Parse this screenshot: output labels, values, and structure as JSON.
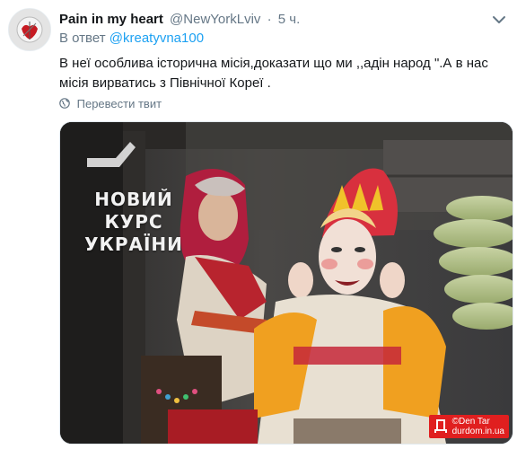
{
  "tweet": {
    "display_name": "Pain in my heart",
    "handle": "@NewYorkLviv",
    "separator": "·",
    "time": "5 ч.",
    "reply_prefix": "В ответ",
    "reply_mention": "@kreatyvna100",
    "text": "В неї особлива історична місія,доказати що ми ,,адін народ \".А в нас місія вирватись з Північної Кореї .",
    "translate_label": "Перевести твит"
  },
  "media": {
    "logo_lines": [
      "НОВИЙ",
      "КУРС",
      "УКРАЇНИ"
    ],
    "watermark_line1": "©Den Tar",
    "watermark_line2": "durdom.in.ua"
  },
  "colors": {
    "link": "#1da1f2",
    "secondary_text": "#657786",
    "watermark_bg": "#e01f1f"
  }
}
